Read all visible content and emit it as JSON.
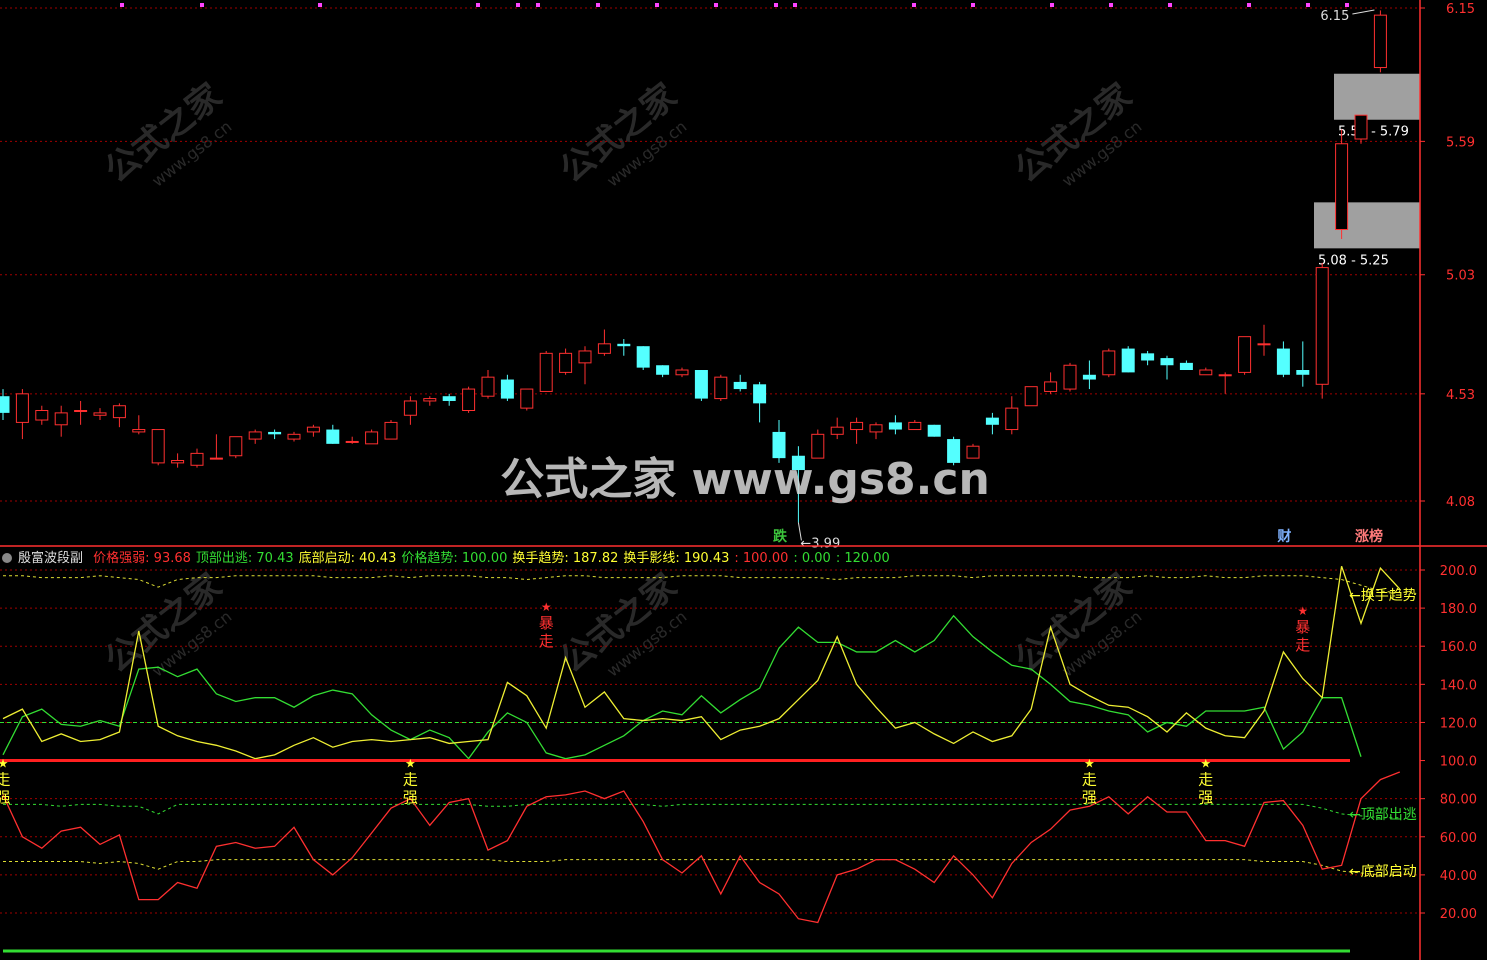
{
  "chart_data": {
    "type": "candlestick",
    "price_axis": {
      "ticks": [
        "6.15",
        "5.59",
        "5.03",
        "4.53",
        "4.08"
      ],
      "values": [
        6.15,
        5.59,
        5.03,
        4.53,
        4.08
      ]
    },
    "candles": [
      [
        4.52,
        4.55,
        4.42,
        4.45
      ],
      [
        4.41,
        4.55,
        4.34,
        4.53
      ],
      [
        4.42,
        4.48,
        4.4,
        4.46
      ],
      [
        4.4,
        4.48,
        4.35,
        4.45
      ],
      [
        4.46,
        4.5,
        4.4,
        4.46
      ],
      [
        4.44,
        4.47,
        4.42,
        4.45
      ],
      [
        4.43,
        4.49,
        4.39,
        4.48
      ],
      [
        4.37,
        4.44,
        4.36,
        4.38
      ],
      [
        4.24,
        4.38,
        4.23,
        4.38
      ],
      [
        4.24,
        4.28,
        4.22,
        4.25
      ],
      [
        4.23,
        4.3,
        4.22,
        4.28
      ],
      [
        4.26,
        4.36,
        4.26,
        4.26
      ],
      [
        4.27,
        4.35,
        4.26,
        4.35
      ],
      [
        4.34,
        4.38,
        4.32,
        4.37
      ],
      [
        4.37,
        4.38,
        4.34,
        4.36
      ],
      [
        4.34,
        4.37,
        4.33,
        4.36
      ],
      [
        4.37,
        4.4,
        4.35,
        4.39
      ],
      [
        4.38,
        4.4,
        4.32,
        4.32
      ],
      [
        4.33,
        4.35,
        4.32,
        4.33
      ],
      [
        4.32,
        4.38,
        4.32,
        4.37
      ],
      [
        4.34,
        4.42,
        4.34,
        4.41
      ],
      [
        4.44,
        4.52,
        4.4,
        4.5
      ],
      [
        4.5,
        4.52,
        4.48,
        4.51
      ],
      [
        4.52,
        4.53,
        4.48,
        4.5
      ],
      [
        4.46,
        4.56,
        4.45,
        4.55
      ],
      [
        4.52,
        4.63,
        4.51,
        4.6
      ],
      [
        4.59,
        4.61,
        4.5,
        4.51
      ],
      [
        4.47,
        4.55,
        4.46,
        4.55
      ],
      [
        4.54,
        4.71,
        4.54,
        4.7
      ],
      [
        4.62,
        4.72,
        4.61,
        4.7
      ],
      [
        4.66,
        4.73,
        4.57,
        4.71
      ],
      [
        4.7,
        4.8,
        4.69,
        4.74
      ],
      [
        4.74,
        4.76,
        4.69,
        4.73
      ],
      [
        4.73,
        4.73,
        4.63,
        4.64
      ],
      [
        4.65,
        4.65,
        4.6,
        4.61
      ],
      [
        4.61,
        4.64,
        4.6,
        4.63
      ],
      [
        4.63,
        4.63,
        4.5,
        4.51
      ],
      [
        4.51,
        4.61,
        4.5,
        4.6
      ],
      [
        4.58,
        4.61,
        4.54,
        4.55
      ],
      [
        4.57,
        4.58,
        4.41,
        4.49
      ],
      [
        4.37,
        4.42,
        4.24,
        4.26
      ],
      [
        4.27,
        4.31,
        3.99,
        4.21
      ],
      [
        4.26,
        4.38,
        4.26,
        4.36
      ],
      [
        4.36,
        4.43,
        4.34,
        4.39
      ],
      [
        4.38,
        4.43,
        4.32,
        4.41
      ],
      [
        4.37,
        4.41,
        4.34,
        4.4
      ],
      [
        4.41,
        4.44,
        4.36,
        4.38
      ],
      [
        4.38,
        4.42,
        4.38,
        4.41
      ],
      [
        4.4,
        4.4,
        4.35,
        4.35
      ],
      [
        4.34,
        4.35,
        4.23,
        4.24
      ],
      [
        4.26,
        4.32,
        4.26,
        4.31
      ],
      [
        4.43,
        4.45,
        4.36,
        4.4
      ],
      [
        4.38,
        4.52,
        4.36,
        4.47
      ],
      [
        4.48,
        4.56,
        4.48,
        4.56
      ],
      [
        4.54,
        4.62,
        4.53,
        4.58
      ],
      [
        4.55,
        4.66,
        4.54,
        4.65
      ],
      [
        4.61,
        4.67,
        4.55,
        4.59
      ],
      [
        4.61,
        4.72,
        4.6,
        4.71
      ],
      [
        4.72,
        4.73,
        4.62,
        4.62
      ],
      [
        4.7,
        4.71,
        4.65,
        4.67
      ],
      [
        4.68,
        4.69,
        4.59,
        4.65
      ],
      [
        4.66,
        4.67,
        4.63,
        4.63
      ],
      [
        4.61,
        4.64,
        4.61,
        4.63
      ],
      [
        4.61,
        4.62,
        4.53,
        4.61
      ],
      [
        4.62,
        4.76,
        4.61,
        4.77
      ],
      [
        4.74,
        4.82,
        4.69,
        4.74
      ],
      [
        4.72,
        4.75,
        4.6,
        4.61
      ],
      [
        4.63,
        4.75,
        4.56,
        4.61
      ],
      [
        4.57,
        5.08,
        4.51,
        5.06
      ],
      [
        5.22,
        5.64,
        5.18,
        5.58
      ],
      [
        5.6,
        5.7,
        5.58,
        5.7
      ],
      [
        5.9,
        6.14,
        5.88,
        6.12
      ]
    ],
    "zones": [
      {
        "label": "5.59 - 5.79",
        "low": 5.59,
        "high": 5.79
      },
      {
        "label": "5.08 - 5.25",
        "low": 5.08,
        "high": 5.25
      }
    ],
    "price_annotations": [
      {
        "text": "6.15",
        "value": 6.15,
        "index": 71
      },
      {
        "text": "3.99",
        "value": 3.99,
        "index": 41
      }
    ],
    "bottom_tags": [
      {
        "text": "跌",
        "index": 40,
        "color": "#3cc43c"
      },
      {
        "text": "财",
        "index": 66,
        "color": "#7fb2ff"
      },
      {
        "text": "涨榜",
        "index": 70,
        "color": "#ff7a7a"
      }
    ],
    "indicator": {
      "name": "殷富波段副",
      "axis_ticks": [
        "200.0",
        "180.0",
        "160.0",
        "140.0",
        "120.0",
        "100.0",
        "80.00",
        "60.00",
        "40.00",
        "20.00"
      ],
      "axis_values": [
        200,
        180,
        160,
        140,
        120,
        100,
        80,
        60,
        40,
        20
      ],
      "legend": [
        {
          "label": "价格强弱:",
          "value": "93.68",
          "color": "#ff3030"
        },
        {
          "label": "顶部出逃:",
          "value": "70.43",
          "color": "#33dd33"
        },
        {
          "label": "底部启动:",
          "value": "40.43",
          "color": "#ffff33"
        },
        {
          "label": "价格趋势:",
          "value": "100.00",
          "color": "#33dd33"
        },
        {
          "label": "换手趋势:",
          "value": "187.82",
          "color": "#ffff33"
        },
        {
          "label": "换手影线:",
          "value": "190.43",
          "color": "#ffff33"
        },
        {
          "label": ":",
          "value": "100.00",
          "color": "#ff3030"
        },
        {
          "label": ":",
          "value": "0.00",
          "color": "#33dd33"
        },
        {
          "label": ":",
          "value": "120.00",
          "color": "#33dd33"
        }
      ],
      "right_labels": [
        {
          "text": "←换手趋势",
          "value": 187,
          "color": "#ffff33"
        },
        {
          "text": "←顶部出逃",
          "value": 72,
          "color": "#33dd33"
        },
        {
          "text": "←底部启动",
          "value": 42,
          "color": "#ffff33"
        }
      ],
      "series": {
        "yellow": [
          122,
          127,
          110,
          114,
          110,
          111,
          115,
          168,
          118,
          113,
          110,
          108,
          105,
          101,
          103,
          108,
          112,
          107,
          110,
          111,
          110,
          111,
          112,
          109,
          110,
          111,
          141,
          134,
          117,
          154,
          128,
          136,
          122,
          121,
          122,
          121,
          123,
          111,
          116,
          118,
          122,
          132,
          142,
          165,
          140,
          128,
          117,
          120,
          114,
          109,
          115,
          110,
          113,
          127,
          170,
          140,
          134,
          129,
          128,
          123,
          115,
          125,
          117,
          113,
          112,
          126,
          157,
          143,
          133,
          202,
          172,
          201,
          190
        ],
        "green": [
          103,
          123,
          127,
          119,
          118,
          121,
          118,
          148,
          149,
          144,
          148,
          135,
          131,
          133,
          133,
          128,
          134,
          137,
          135,
          124,
          116,
          111,
          116,
          112,
          101,
          115,
          125,
          120,
          104,
          101,
          103,
          108,
          113,
          121,
          126,
          124,
          134,
          125,
          132,
          138,
          159,
          170,
          162,
          162,
          157,
          157,
          163,
          157,
          163,
          176,
          165,
          157,
          150,
          148,
          140,
          131,
          129,
          126,
          124,
          115,
          120,
          118,
          126,
          126,
          126,
          128,
          106,
          115,
          133,
          133,
          102
        ],
        "red": [
          82,
          60,
          54,
          63,
          65,
          56,
          61,
          27,
          27,
          36,
          33,
          55,
          57,
          54,
          55,
          65,
          48,
          40,
          49,
          62,
          75,
          80,
          66,
          78,
          80,
          53,
          58,
          76,
          81,
          82,
          84,
          80,
          84,
          68,
          48,
          41,
          50,
          30,
          50,
          36,
          30,
          17,
          15,
          40,
          43,
          48,
          48,
          43,
          36,
          50,
          40,
          28,
          46,
          57,
          64,
          74,
          76,
          81,
          72,
          81,
          73,
          73,
          58,
          58,
          55,
          78,
          79,
          66,
          43,
          45,
          80,
          90,
          94
        ],
        "dash_yellow_top": [
          197,
          197,
          196,
          196,
          196,
          197,
          196,
          195,
          191,
          195,
          196,
          196,
          197,
          197,
          197,
          197,
          197,
          196,
          196,
          196,
          197,
          196,
          197,
          197,
          197,
          196,
          196,
          195,
          196,
          197,
          197,
          196,
          196,
          196,
          196,
          197,
          197,
          197,
          196,
          196,
          196,
          196,
          196,
          195,
          196,
          196,
          196,
          197,
          197,
          197,
          196,
          197,
          197,
          197,
          197,
          197,
          196,
          196,
          196,
          197,
          196,
          196,
          197,
          196,
          196,
          197,
          197,
          197,
          196,
          195,
          192,
          189,
          188
        ],
        "dash_green_mid": [
          77,
          77,
          77,
          76,
          77,
          77,
          76,
          76,
          72,
          77,
          77,
          77,
          77,
          77,
          77,
          77,
          77,
          77,
          77,
          77,
          77,
          77,
          77,
          77,
          77,
          76,
          76,
          77,
          77,
          77,
          77,
          77,
          77,
          77,
          76,
          77,
          77,
          77,
          77,
          77,
          77,
          77,
          77,
          77,
          77,
          77,
          77,
          77,
          77,
          77,
          77,
          77,
          77,
          77,
          77,
          77,
          77,
          77,
          77,
          77,
          77,
          77,
          77,
          77,
          77,
          77,
          77,
          77,
          75,
          72,
          71,
          70,
          70
        ],
        "dash_yellow_low": [
          47,
          47,
          47,
          47,
          47,
          46,
          47,
          46,
          43,
          47,
          47,
          48,
          48,
          48,
          48,
          48,
          48,
          48,
          48,
          48,
          48,
          48,
          48,
          48,
          48,
          48,
          47,
          47,
          47,
          48,
          48,
          48,
          48,
          48,
          48,
          48,
          48,
          48,
          48,
          48,
          48,
          48,
          48,
          48,
          48,
          48,
          48,
          48,
          48,
          48,
          48,
          48,
          48,
          48,
          48,
          48,
          48,
          48,
          48,
          48,
          48,
          48,
          48,
          48,
          48,
          47,
          47,
          47,
          45,
          42,
          41,
          40,
          40
        ],
        "dash_green_120": 120
      },
      "signals": [
        {
          "text1": "暴",
          "text2": "走",
          "index": 28,
          "color": "#ff3030",
          "value": 180
        },
        {
          "text1": "暴",
          "text2": "走",
          "index": 67,
          "color": "#ff3030",
          "value": 178
        },
        {
          "text1": "走",
          "text2": "强",
          "index": 0,
          "color": "#ffff33",
          "value": 98
        },
        {
          "text1": "走",
          "text2": "强",
          "index": 21,
          "color": "#ffff33",
          "value": 98
        },
        {
          "text1": "走",
          "text2": "强",
          "index": 56,
          "color": "#ffff33",
          "value": 98
        },
        {
          "text1": "走",
          "text2": "强",
          "index": 62,
          "color": "#ffff33",
          "value": 98
        }
      ]
    }
  },
  "watermark": {
    "main": "公式之家 www.gs8.cn",
    "small_cn": "公式之家",
    "small_url": "www.gs8.cn"
  },
  "colors": {
    "up": "#ff3030",
    "down": "#54ffff",
    "grid": "#a00000",
    "axis": "#ff3030"
  }
}
